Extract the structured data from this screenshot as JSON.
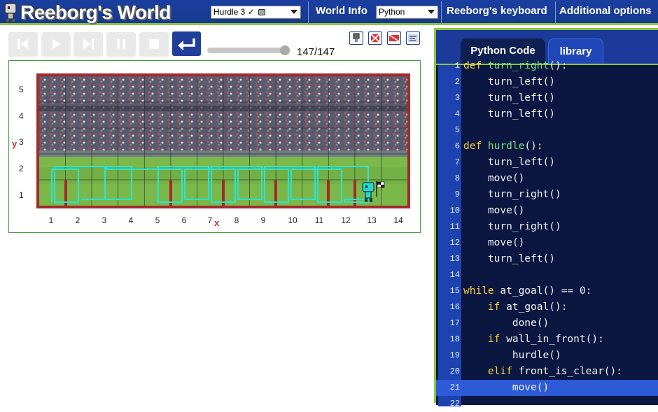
{
  "header": {
    "app_title": "Reeborg's World",
    "world_select": "Hurdle 3 ✓",
    "world_info_label": "World Info",
    "language_select": "Python",
    "keyboard_label": "Reeborg's keyboard",
    "options_label": "Additional options"
  },
  "controls": {
    "buttons": [
      "reload",
      "run",
      "step",
      "pause",
      "stop",
      "step-return"
    ],
    "step_counter": "147/147",
    "slider_fraction": 1.0
  },
  "world": {
    "y_ticks": [
      "5",
      "4",
      "3",
      "2",
      "1"
    ],
    "x_ticks": [
      "1",
      "2",
      "3",
      "4",
      "5",
      "6",
      "7",
      "8",
      "9",
      "10",
      "11",
      "12",
      "13",
      "14"
    ],
    "x_axis_name": "x",
    "y_axis_name": "y",
    "colors": {
      "wall": "#a42a2a",
      "path": "#29e3d6",
      "grass": "#7ab84a"
    }
  },
  "editor": {
    "tabs": [
      "Python Code",
      "library"
    ],
    "highlighted_line": 21,
    "lines": [
      {
        "n": "1",
        "segments": [
          {
            "t": "def ",
            "c": "kw"
          },
          {
            "t": "turn_right",
            "c": "fn"
          },
          {
            "t": "():",
            "c": ""
          }
        ]
      },
      {
        "n": "2",
        "segments": [
          {
            "t": "    turn_left()",
            "c": ""
          }
        ]
      },
      {
        "n": "3",
        "segments": [
          {
            "t": "    turn_left()",
            "c": ""
          }
        ]
      },
      {
        "n": "4",
        "segments": [
          {
            "t": "    turn_left()",
            "c": ""
          }
        ]
      },
      {
        "n": "5",
        "segments": []
      },
      {
        "n": "6",
        "segments": [
          {
            "t": "def ",
            "c": "kw"
          },
          {
            "t": "hurdle",
            "c": "fn"
          },
          {
            "t": "():",
            "c": ""
          }
        ]
      },
      {
        "n": "7",
        "segments": [
          {
            "t": "    turn_left()",
            "c": ""
          }
        ]
      },
      {
        "n": "8",
        "segments": [
          {
            "t": "    move()",
            "c": ""
          }
        ]
      },
      {
        "n": "9",
        "segments": [
          {
            "t": "    turn_right()",
            "c": ""
          }
        ]
      },
      {
        "n": "10",
        "segments": [
          {
            "t": "    move()",
            "c": ""
          }
        ]
      },
      {
        "n": "11",
        "segments": [
          {
            "t": "    turn_right()",
            "c": ""
          }
        ]
      },
      {
        "n": "12",
        "segments": [
          {
            "t": "    move()",
            "c": ""
          }
        ]
      },
      {
        "n": "13",
        "segments": [
          {
            "t": "    turn_left()",
            "c": ""
          }
        ]
      },
      {
        "n": "14",
        "segments": []
      },
      {
        "n": "15",
        "segments": [
          {
            "t": "while ",
            "c": "kw"
          },
          {
            "t": "at_goal() == 0:",
            "c": ""
          }
        ]
      },
      {
        "n": "16",
        "segments": [
          {
            "t": "    ",
            "c": ""
          },
          {
            "t": "if ",
            "c": "kw"
          },
          {
            "t": "at_goal():",
            "c": ""
          }
        ]
      },
      {
        "n": "17",
        "segments": [
          {
            "t": "        done()",
            "c": ""
          }
        ]
      },
      {
        "n": "18",
        "segments": [
          {
            "t": "    ",
            "c": ""
          },
          {
            "t": "if ",
            "c": "kw"
          },
          {
            "t": "wall_in_front():",
            "c": ""
          }
        ]
      },
      {
        "n": "19",
        "segments": [
          {
            "t": "        hurdle()",
            "c": ""
          }
        ]
      },
      {
        "n": "20",
        "segments": [
          {
            "t": "    ",
            "c": ""
          },
          {
            "t": "elif ",
            "c": "kw"
          },
          {
            "t": "front_is_clear():",
            "c": ""
          }
        ]
      },
      {
        "n": "21",
        "segments": [
          {
            "t": "        move()",
            "c": ""
          }
        ]
      },
      {
        "n": "22",
        "segments": []
      }
    ]
  }
}
